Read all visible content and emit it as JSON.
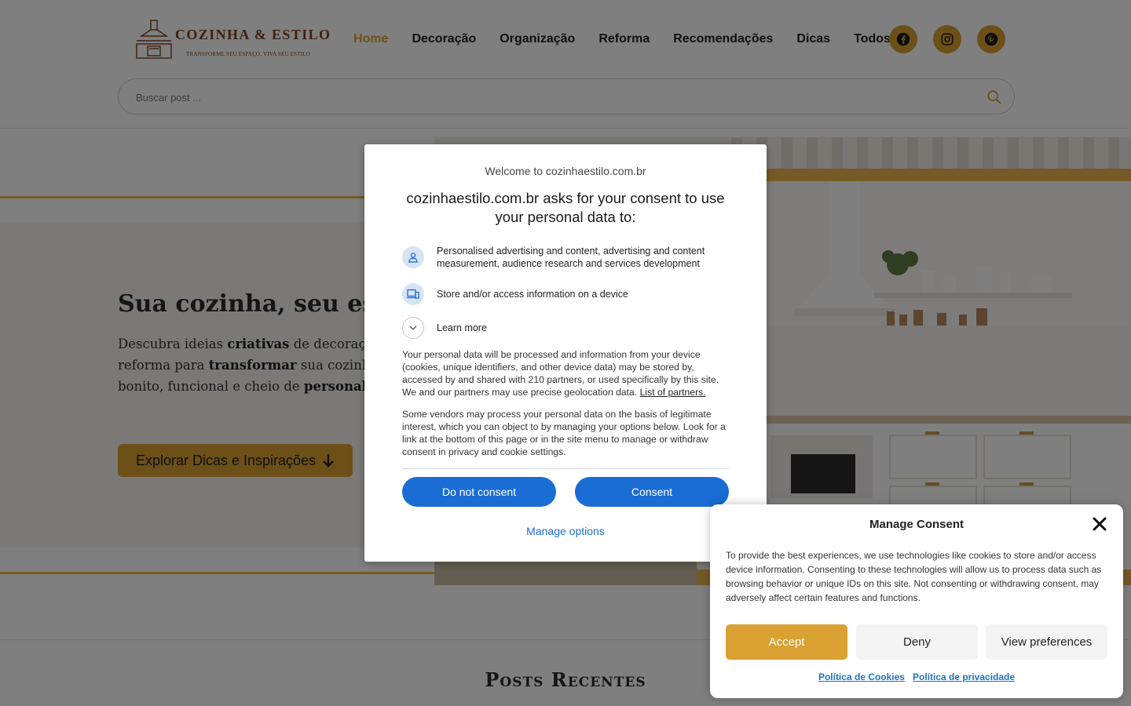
{
  "site": {
    "logo_title": "COZINHA & ESTILO",
    "logo_tagline": "TRANSFORME SEU ESPAÇO, VIVA SEU ESTILO",
    "accent_color": "#d9a131",
    "brand_color": "#7c3f1a"
  },
  "nav": {
    "items": [
      {
        "label": "Home",
        "active": true
      },
      {
        "label": "Decoração"
      },
      {
        "label": "Organização"
      },
      {
        "label": "Reforma"
      },
      {
        "label": "Recomendações"
      },
      {
        "label": "Dicas"
      },
      {
        "label": "Todos"
      }
    ]
  },
  "social": {
    "icons": [
      "facebook-icon",
      "instagram-icon",
      "pinterest-icon"
    ]
  },
  "search": {
    "placeholder": "Buscar post ...",
    "value": ""
  },
  "hero": {
    "title": "Sua cozinha, seu estilo.",
    "desc": {
      "p1": "Descubra ideias ",
      "b1": "criativas",
      "p2": " de decoração, organização e reforma para ",
      "b2": "transformar",
      "p3": " sua cozinha em um espaço bonito, funcional e cheio de ",
      "b3": "personalidade",
      "p4": "."
    },
    "cta_label": "Explorar Dicas e Inspirações"
  },
  "posts": {
    "heading": "Posts Recentes"
  },
  "consent_modal": {
    "welcome": "Welcome to cozinhaestilo.com.br",
    "heading": "cozinhaestilo.com.br asks for your consent to use your personal data to:",
    "purposes": [
      {
        "icon": "person-icon",
        "text": "Personalised advertising and content, advertising and content measurement, audience research and services development"
      },
      {
        "icon": "device-icon",
        "text": "Store and/or access information on a device"
      }
    ],
    "learn_more": "Learn more",
    "para1": "Your personal data will be processed and information from your device (cookies, unique identifiers, and other device data) may be stored by, accessed by and shared with 210 partners, or used specifically by this site. We and our partners may use precise geolocation data. ",
    "partners_link": "List of partners.",
    "para2": "Some vendors may process your personal data on the basis of legitimate interest, which you can object to by managing your options below. Look for a link at the bottom of this page or in the site menu to manage or withdraw consent in privacy and cookie settings.",
    "btn_do_not_consent": "Do not consent",
    "btn_consent": "Consent",
    "manage_options": "Manage options",
    "button_color": "#1a6dd4"
  },
  "cookie_panel": {
    "title": "Manage Consent",
    "text": "To provide the best experiences, we use technologies like cookies to store and/or access device information. Consenting to these technologies will allow us to process data such as browsing behavior or unique IDs on this site. Not consenting or withdrawing consent, may adversely affect certain features and functions.",
    "btn_accept": "Accept",
    "btn_deny": "Deny",
    "btn_view_preferences": "View preferences",
    "link_cookie_policy": "Política de Cookies",
    "link_privacy_policy": "Política de privacidade"
  }
}
